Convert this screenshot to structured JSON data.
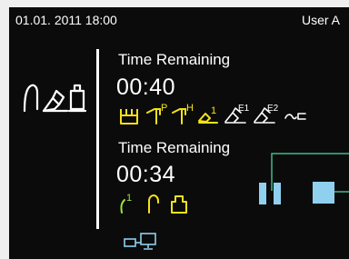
{
  "status": {
    "datetime": "01.01. 2011 18:00",
    "user": "User A"
  },
  "timer1": {
    "label": "Time Remaining",
    "value": "00:40",
    "icons": [
      {
        "name": "handpiece-tray-icon",
        "color": "#f5e21a"
      },
      {
        "name": "scaler-p-icon",
        "color": "#f5e21a",
        "sup": "P"
      },
      {
        "name": "scaler-h-icon",
        "color": "#f5e21a",
        "sup": "H"
      },
      {
        "name": "turbine-1-icon",
        "color": "#f5e21a",
        "sup": "1"
      },
      {
        "name": "micromotor-e1-icon",
        "color": "#ffffff",
        "sup": "E1"
      },
      {
        "name": "micromotor-e2-icon",
        "color": "#ffffff",
        "sup": "E2"
      },
      {
        "name": "syringe-icon",
        "color": "#ffffff"
      }
    ]
  },
  "timer2": {
    "label": "Time Remaining",
    "value": "00:34",
    "icons": [
      {
        "name": "suction-1-icon",
        "color": "#9ee33a",
        "sup": "1"
      },
      {
        "name": "suction-hook-icon",
        "color": "#f5e21a"
      },
      {
        "name": "cup-holder-icon",
        "color": "#f5e21a"
      }
    ]
  },
  "colors": {
    "accent_yellow": "#f5e21a",
    "accent_green": "#9ee33a",
    "indicator_blue": "#8fd0ee",
    "connector_green": "#3fb98a"
  }
}
